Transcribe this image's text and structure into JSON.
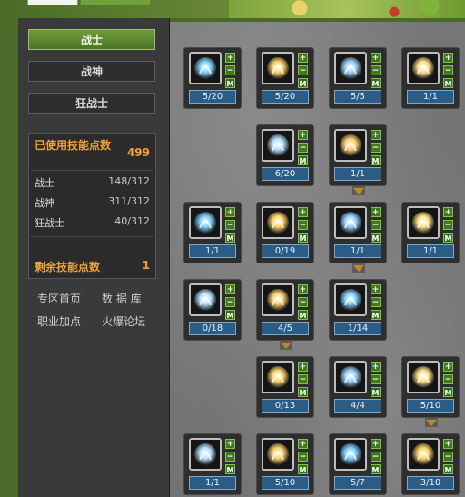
{
  "sidebar": {
    "tabs": [
      {
        "label": "战士"
      },
      {
        "label": "战神"
      },
      {
        "label": "狂战士"
      }
    ],
    "stats": {
      "used_label": "已使用技能点数",
      "used_value": "499",
      "rows": [
        {
          "name": "战士",
          "value": "148/312"
        },
        {
          "name": "战神",
          "value": "311/312"
        },
        {
          "name": "狂战士",
          "value": "40/312"
        }
      ],
      "remain_label": "剩余技能点数",
      "remain_value": "1"
    },
    "links": [
      "专区首页",
      "数 据 库",
      "职业加点",
      "火爆论坛"
    ]
  },
  "skills": [
    {
      "level": "5/20",
      "icon": "spiral-icon"
    },
    {
      "level": "5/20",
      "icon": "blade-icon"
    },
    {
      "level": "5/5",
      "icon": "burst-icon"
    },
    {
      "level": "1/1",
      "icon": "arm-icon"
    },
    {
      "level": "6/20",
      "icon": "sword-icon"
    },
    {
      "level": "1/1",
      "icon": "wing-icon"
    },
    {
      "level": "1/1",
      "icon": "totem-icon"
    },
    {
      "level": "0/19",
      "icon": "slash-icon"
    },
    {
      "level": "1/1",
      "icon": "fist-icon"
    },
    {
      "level": "1/1",
      "icon": "muscle-icon"
    },
    {
      "level": "0/18",
      "icon": "fountain-icon"
    },
    {
      "level": "4/5",
      "icon": "runner-icon"
    },
    {
      "level": "1/14",
      "icon": "heart-icon"
    },
    {
      "level": "0/13",
      "icon": "flex-icon"
    },
    {
      "level": "4/4",
      "icon": "figure-icon"
    },
    {
      "level": "5/10",
      "icon": "flame-icon"
    },
    {
      "level": "1/1",
      "icon": "orb-icon"
    },
    {
      "level": "5/10",
      "icon": "shell-icon"
    },
    {
      "level": "5/7",
      "icon": "splash-icon"
    },
    {
      "level": "3/10",
      "icon": "crown-icon"
    }
  ],
  "buttons": {
    "plus": "+",
    "minus": "−",
    "max": "M"
  },
  "colors": {
    "accent": "#6f9a3b",
    "gold": "#f0a23a",
    "level_bg": "#2a5c86"
  }
}
